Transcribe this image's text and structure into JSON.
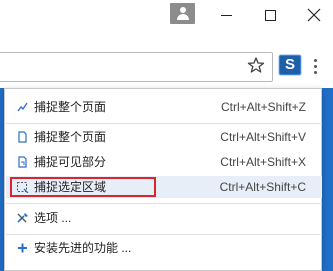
{
  "browser": {
    "extension_letter": "S"
  },
  "menu": {
    "items": [
      {
        "label": "捕捉整个页面",
        "shortcut": "Ctrl+Alt+Shift+Z",
        "icon": "pen-icon"
      },
      {
        "label": "捕捉整个页面",
        "shortcut": "Ctrl+Alt+Shift+V",
        "icon": "page-icon"
      },
      {
        "label": "捕捉可见部分",
        "shortcut": "Ctrl+Alt+Shift+X",
        "icon": "visible-area-icon"
      },
      {
        "label": "捕捉选定区域",
        "shortcut": "Ctrl+Alt+Shift+C",
        "icon": "selection-icon"
      },
      {
        "label": "选项 ...",
        "shortcut": "",
        "icon": "tools-icon"
      },
      {
        "label": "安装先进的功能 ...",
        "shortcut": "",
        "icon": "plus-icon"
      }
    ],
    "highlighted_index": 3
  },
  "colors": {
    "highlight_box": "#d9262c",
    "accent_blue": "#1f6fc8",
    "extension_bg": "#1e5fa8"
  }
}
